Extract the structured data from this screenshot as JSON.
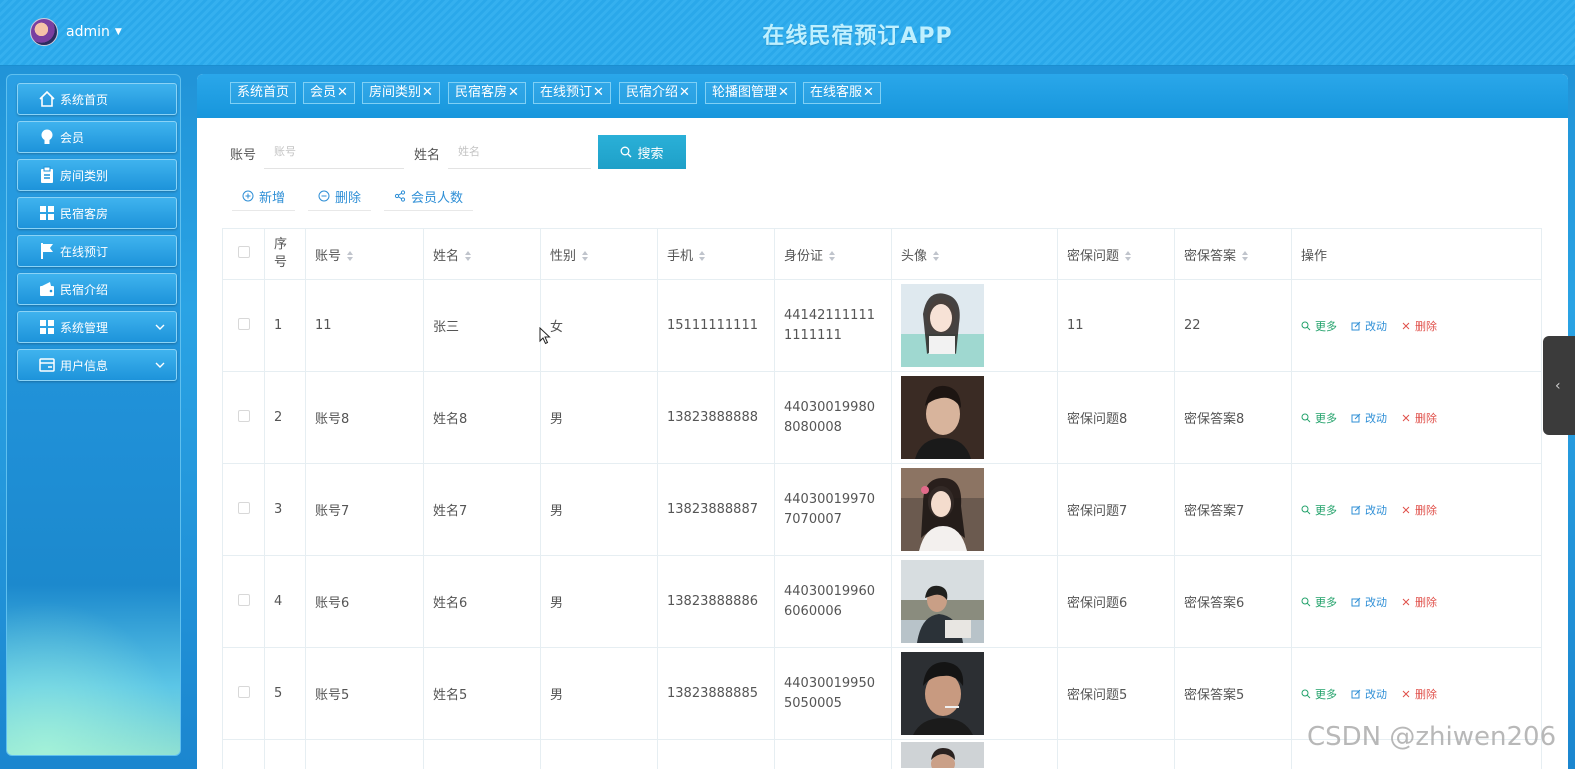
{
  "header": {
    "user_name": "admin",
    "app_title": "在线民宿预订APP"
  },
  "sidebar": {
    "items": [
      {
        "label": "系统首页",
        "icon": "home-icon"
      },
      {
        "label": "会员",
        "icon": "bulb-icon"
      },
      {
        "label": "房间类别",
        "icon": "clipboard-icon"
      },
      {
        "label": "民宿客房",
        "icon": "grid-icon"
      },
      {
        "label": "在线预订",
        "icon": "flag-icon"
      },
      {
        "label": "民宿介绍",
        "icon": "wallet-icon"
      },
      {
        "label": "系统管理",
        "icon": "grid-icon",
        "expandable": true
      },
      {
        "label": "用户信息",
        "icon": "card-icon",
        "expandable": true
      }
    ]
  },
  "tabs": [
    {
      "label": "系统首页",
      "closable": false
    },
    {
      "label": "会员",
      "closable": true
    },
    {
      "label": "房间类别",
      "closable": true
    },
    {
      "label": "民宿客房",
      "closable": true
    },
    {
      "label": "在线预订",
      "closable": true
    },
    {
      "label": "民宿介绍",
      "closable": true
    },
    {
      "label": "轮播图管理",
      "closable": true
    },
    {
      "label": "在线客服",
      "closable": true
    }
  ],
  "tab_close_glyph": "✕",
  "search": {
    "account_label": "账号",
    "account_placeholder": "账号",
    "name_label": "姓名",
    "name_placeholder": "姓名",
    "button_label": "搜索"
  },
  "actions": {
    "add_label": "新增",
    "delete_label": "删除",
    "count_label": "会员人数"
  },
  "table": {
    "headers": {
      "index": "序号",
      "account": "账号",
      "name": "姓名",
      "gender": "性别",
      "phone": "手机",
      "id_card": "身份证",
      "avatar": "头像",
      "question": "密保问题",
      "answer": "密保答案",
      "ops": "操作"
    },
    "op_labels": {
      "more": "更多",
      "edit": "改动",
      "delete": "删除"
    },
    "rows": [
      {
        "index": "1",
        "account": "11",
        "name": "张三",
        "gender": "女",
        "phone": "15111111111",
        "id_card": "441421111111111111",
        "question": "11",
        "answer": "22"
      },
      {
        "index": "2",
        "account": "账号8",
        "name": "姓名8",
        "gender": "男",
        "phone": "13823888888",
        "id_card": "440300199808080008",
        "question": "密保问题8",
        "answer": "密保答案8"
      },
      {
        "index": "3",
        "account": "账号7",
        "name": "姓名7",
        "gender": "男",
        "phone": "13823888887",
        "id_card": "440300199707070007",
        "question": "密保问题7",
        "answer": "密保答案7"
      },
      {
        "index": "4",
        "account": "账号6",
        "name": "姓名6",
        "gender": "男",
        "phone": "13823888886",
        "id_card": "440300199606060006",
        "question": "密保问题6",
        "answer": "密保答案6"
      },
      {
        "index": "5",
        "account": "账号5",
        "name": "姓名5",
        "gender": "男",
        "phone": "13823888885",
        "id_card": "440300199505050005",
        "question": "密保问题5",
        "answer": "密保答案5"
      }
    ]
  },
  "watermark": "CSDN @zhiwen206",
  "colors": {
    "accent": "#1e93d8",
    "op_more": "#23a26b",
    "op_edit": "#2f8fd6",
    "op_delete": "#e0504a"
  }
}
